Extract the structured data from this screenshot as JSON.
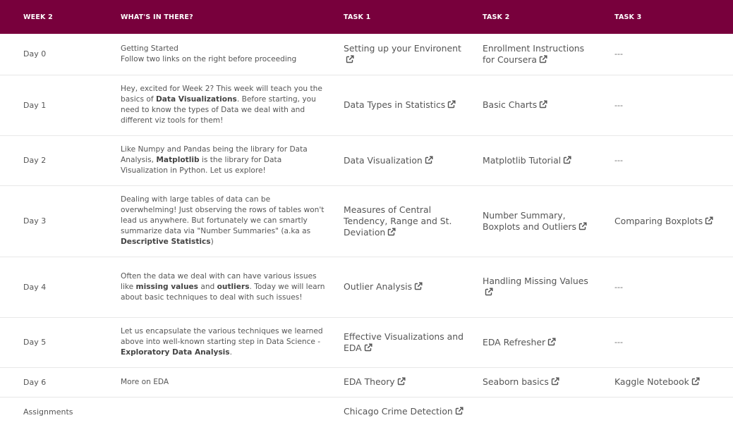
{
  "headers": [
    "WEEK 2",
    "WHAT'S IN THERE?",
    "TASK 1",
    "TASK 2",
    "TASK 3"
  ],
  "empty_marker": "---",
  "accent_color": "#78003c",
  "link_icon": "external-link-icon",
  "rows": [
    {
      "day": "Day 0",
      "desc": [
        {
          "t": "Getting Started"
        },
        {
          "t": "\n"
        },
        {
          "t": "Follow two links on the right before proceeding"
        }
      ],
      "t1": "Setting up your Environent",
      "t2": "Enrollment Instructions for Coursera",
      "t3": null
    },
    {
      "day": "Day 1",
      "desc": [
        {
          "t": "Hey, excited for Week 2? This week will teach you the basics of "
        },
        {
          "t": "Data Visualizations",
          "b": true
        },
        {
          "t": ". Before starting, you need to know the types of Data we deal with and different viz tools for them!"
        }
      ],
      "t1": "Data Types in Statistics",
      "t2": "Basic Charts",
      "t3": null
    },
    {
      "day": "Day 2",
      "desc": [
        {
          "t": "Like Numpy and Pandas being the library for Data Analysis, "
        },
        {
          "t": "Matplotlib",
          "b": true
        },
        {
          "t": " is the library for Data Visualization in Python. Let us explore!"
        }
      ],
      "t1": "Data Visualization",
      "t2": "Matplotlib Tutorial",
      "t3": null
    },
    {
      "day": "Day 3",
      "desc": [
        {
          "t": "Dealing with large tables of data can be overwhelming! Just observing the rows of tables won't lead us anywhere. But fortunately we can smartly summarize data via \"Number Summaries\" (a.ka as "
        },
        {
          "t": "Descriptive Statistics",
          "b": true
        },
        {
          "t": ")"
        }
      ],
      "t1": "Measures of Central Tendency, Range and St. Deviation",
      "t2": "Number Summary, Boxplots and Outliers",
      "t3": "Comparing Boxplots"
    },
    {
      "day": "Day 4",
      "desc": [
        {
          "t": "Often the data we deal with can have various issues like "
        },
        {
          "t": "missing values",
          "b": true
        },
        {
          "t": " and "
        },
        {
          "t": "outliers",
          "b": true
        },
        {
          "t": ". Today we will learn about basic techniques to deal with such issues!"
        }
      ],
      "t1": "Outlier Analysis",
      "t2": "Handling Missing Values",
      "t3": null
    },
    {
      "day": "Day 5",
      "desc": [
        {
          "t": "Let us encapsulate the various techniques we learned above into well-known starting step in Data Science - "
        },
        {
          "t": "Exploratory Data Analysis",
          "b": true
        },
        {
          "t": "."
        }
      ],
      "t1": "Effective Visualizations and EDA",
      "t2": "EDA Refresher",
      "t3": null
    },
    {
      "day": "Day 6",
      "desc": [
        {
          "t": "More on EDA"
        }
      ],
      "t1": "EDA Theory",
      "t2": "Seaborn basics",
      "t3": "Kaggle Notebook"
    },
    {
      "day": "Assignments",
      "desc": [],
      "t1": "Chicago Crime Detection",
      "t2": "",
      "t3": ""
    }
  ]
}
